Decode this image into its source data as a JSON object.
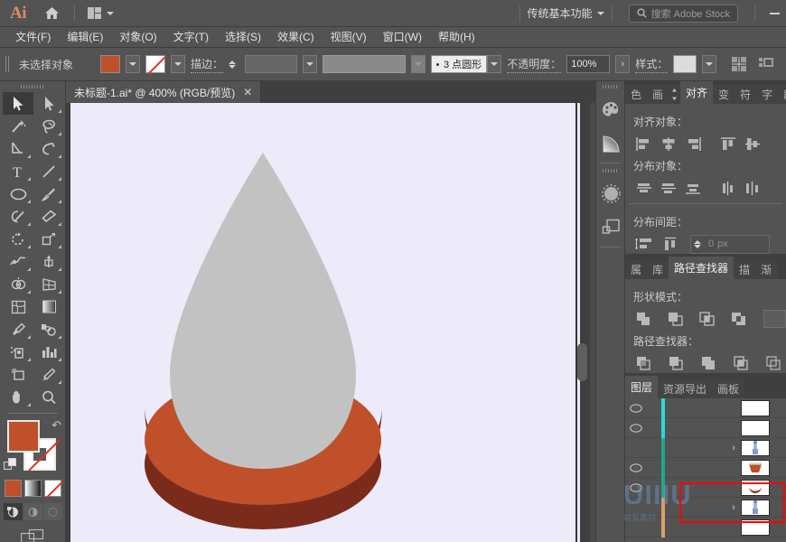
{
  "app": {
    "name": "Ai",
    "logo_color": "#d98c5f",
    "home_icon": "home-icon"
  },
  "topbar": {
    "arrange_icon": "arrange-documents-icon",
    "workspace": "传统基本功能",
    "workspace_caret": "chevron-down-icon",
    "search": {
      "icon": "search-icon",
      "placeholder": "搜索 Adobe Stock",
      "value": ""
    },
    "minimize": "minimize-icon"
  },
  "menubar": {
    "items": [
      {
        "label": "文件(F)"
      },
      {
        "label": "编辑(E)"
      },
      {
        "label": "对象(O)"
      },
      {
        "label": "文字(T)"
      },
      {
        "label": "选择(S)"
      },
      {
        "label": "效果(C)"
      },
      {
        "label": "视图(V)"
      },
      {
        "label": "窗口(W)"
      },
      {
        "label": "帮助(H)"
      }
    ]
  },
  "controlbar": {
    "selection_status": "未选择对象",
    "fill_color": "#c0502a",
    "stroke_color": "none",
    "stroke_label": "描边：",
    "stroke_weight": "",
    "brush_label": "3 点圆形",
    "opacity_label": "不透明度：",
    "opacity_value": "100%",
    "style_label": "样式：",
    "style_swatch": "#dcdcdc",
    "align_icon": "align-icon",
    "distribute_icon": "distribute-icon"
  },
  "document": {
    "tab_title": "未标题-1.ai* @ 400% (RGB/预览)",
    "close_label": "✕",
    "zoom": "400%",
    "color_mode": "RGB",
    "view_mode": "预览",
    "canvas_bg": "#edeafa"
  },
  "artwork": {
    "drop_fill": "#c2c2c2",
    "base_top_fill": "#c0502a",
    "base_bottom_fill": "#7a2b1c"
  },
  "toolbar": {
    "tools": [
      {
        "name": "selection-tool",
        "active": true
      },
      {
        "name": "direct-selection-tool",
        "active": false
      },
      {
        "name": "magic-wand-tool",
        "active": false
      },
      {
        "name": "lasso-tool",
        "active": false
      },
      {
        "name": "pen-tool",
        "active": false
      },
      {
        "name": "curvature-tool",
        "active": false
      },
      {
        "name": "type-tool",
        "active": false
      },
      {
        "name": "line-segment-tool",
        "active": false
      },
      {
        "name": "ellipse-tool",
        "active": false
      },
      {
        "name": "paintbrush-tool",
        "active": false
      },
      {
        "name": "shaper-tool",
        "active": false
      },
      {
        "name": "eraser-tool",
        "active": false
      },
      {
        "name": "rotate-tool",
        "active": false
      },
      {
        "name": "scale-tool",
        "active": false
      },
      {
        "name": "width-tool",
        "active": false
      },
      {
        "name": "free-transform-tool",
        "active": false
      },
      {
        "name": "shape-builder-tool",
        "active": false
      },
      {
        "name": "perspective-grid-tool",
        "active": false
      },
      {
        "name": "mesh-tool",
        "active": false
      },
      {
        "name": "gradient-tool",
        "active": false
      },
      {
        "name": "eyedropper-tool",
        "active": false
      },
      {
        "name": "blend-tool",
        "active": false
      },
      {
        "name": "symbol-sprayer-tool",
        "active": false
      },
      {
        "name": "column-graph-tool",
        "active": false
      },
      {
        "name": "artboard-tool",
        "active": false
      },
      {
        "name": "slice-tool",
        "active": false
      },
      {
        "name": "hand-tool",
        "active": false
      },
      {
        "name": "zoom-tool",
        "active": false
      }
    ],
    "fill_color": "#c0502a",
    "stroke_color": "none",
    "color_mode_buttons": [
      "color-button",
      "gradient-button",
      "none-button"
    ],
    "drawing_modes": [
      "draw-normal",
      "draw-behind",
      "draw-inside"
    ],
    "screen_mode": "screen-mode-button"
  },
  "icondock": {
    "buttons": [
      {
        "name": "color-panel-icon"
      },
      {
        "name": "gradient-panel-icon"
      },
      {
        "name": "brushes-panel-icon"
      },
      {
        "name": "symbols-panel-icon"
      }
    ]
  },
  "align_panel": {
    "tabs": [
      {
        "label": "色",
        "active": false
      },
      {
        "label": "画",
        "active": false
      },
      {
        "label": "对齐",
        "active": true
      },
      {
        "label": "变",
        "active": false
      },
      {
        "label": "符",
        "active": false
      },
      {
        "label": "字",
        "active": false
      },
      {
        "label": "段",
        "active": false
      }
    ],
    "align_objects_title": "对齐对象：",
    "align_buttons": [
      "align-left-icon",
      "align-horizontal-center-icon",
      "align-right-icon",
      "align-top-icon",
      "align-vertical-center-icon"
    ],
    "distribute_objects_title": "分布对象：",
    "distribute_buttons": [
      "distribute-vertical-top-icon",
      "distribute-vertical-center-icon",
      "distribute-vertical-bottom-icon",
      "distribute-horizontal-left-icon",
      "distribute-horizontal-center-icon"
    ],
    "distribute_spacing_title": "分布间距：",
    "spacing_buttons": [
      "vertical-distribute-space-icon",
      "horizontal-distribute-space-icon"
    ],
    "spacing_value": "0",
    "spacing_unit": "px"
  },
  "pathfinder_panel": {
    "tabs": [
      {
        "label": "属",
        "active": false
      },
      {
        "label": "库",
        "active": false
      },
      {
        "label": "路径查找器",
        "active": true
      },
      {
        "label": "描",
        "active": false
      },
      {
        "label": "渐",
        "active": false
      }
    ],
    "shape_modes_title": "形状模式：",
    "shape_mode_buttons": [
      "unite-icon",
      "minus-front-icon",
      "intersect-icon",
      "exclude-icon"
    ],
    "expand_label": "",
    "pathfinders_title": "路径查找器：",
    "pathfinder_buttons": [
      "divide-icon",
      "trim-icon",
      "merge-icon",
      "crop-icon",
      "outline-icon"
    ]
  },
  "layers_panel": {
    "tabs": [
      {
        "label": "图层",
        "active": true
      },
      {
        "label": "资源导出",
        "active": false
      },
      {
        "label": "画板",
        "active": false
      }
    ],
    "rows": [
      {
        "visible": true,
        "color": "#2ad8d8",
        "indent": 0,
        "expand": "",
        "thumb": "blank",
        "target": false
      },
      {
        "visible": true,
        "color": "#2ad8d8",
        "indent": 0,
        "expand": "",
        "thumb": "blank",
        "target": false
      },
      {
        "visible": false,
        "color": "#1fa88c",
        "indent": 1,
        "expand": "›",
        "thumb": "bottle",
        "target": false
      },
      {
        "visible": true,
        "color": "#1fa88c",
        "indent": 1,
        "expand": "",
        "thumb": "bowl",
        "target": true
      },
      {
        "visible": true,
        "color": "#1fa88c",
        "indent": 1,
        "expand": "",
        "thumb": "arc",
        "target": true
      },
      {
        "visible": false,
        "color": "#d9a066",
        "indent": 1,
        "expand": "›",
        "thumb": "bottle",
        "target": false
      },
      {
        "visible": false,
        "color": "#d9a066",
        "indent": 1,
        "expand": "",
        "thumb": "blank",
        "target": false
      }
    ],
    "highlight_color": "#ff0000"
  },
  "watermark": {
    "text": "UIIIU",
    "subtext": "站长素材"
  }
}
